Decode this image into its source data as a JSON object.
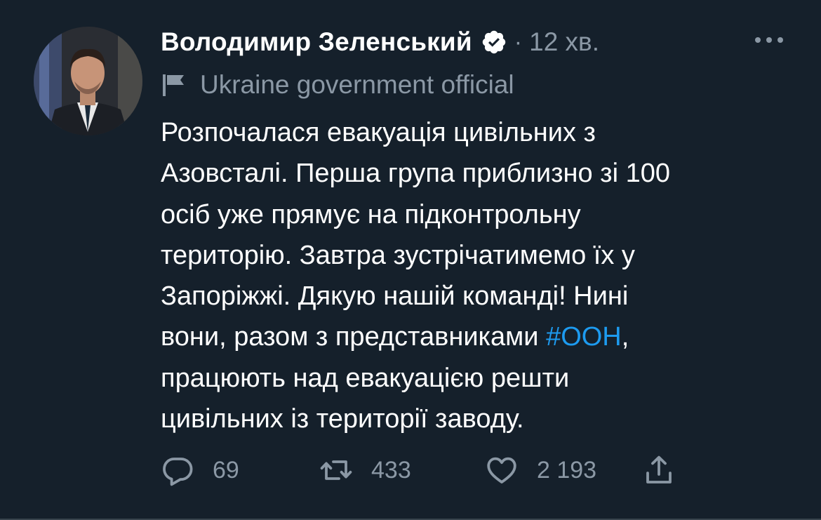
{
  "tweet": {
    "author_name": "Володимир Зеленський",
    "separator": "·",
    "time": "12 хв.",
    "label": "Ukraine government official",
    "body_lines": [
      "Розпочалася евакуація цивільних з",
      "Азовсталі. Перша група приблизно зі 100",
      "осіб уже прямує на підконтрольну",
      "територію. Завтра зустрічатимемо їх у",
      "Запоріжжі. Дякую нашій команді! Нині"
    ],
    "body_line6_before": "вони, разом з представниками ",
    "hashtag": "#ООН",
    "body_line6_after": ",",
    "body_lines_end": [
      "працюють над евакуацією решти",
      "цивільних із території заводу."
    ]
  },
  "actions": {
    "replies": "69",
    "retweets": "433",
    "likes": "2 193"
  },
  "icons": {
    "verified": "verified-badge-icon",
    "more": "more-options-icon",
    "label": "flag-icon",
    "reply": "reply-icon",
    "retweet": "retweet-icon",
    "like": "heart-icon",
    "share": "share-icon"
  },
  "colors": {
    "background": "#15202b",
    "text": "#ffffff",
    "secondary": "#8b98a5",
    "link": "#1d9bf0"
  }
}
